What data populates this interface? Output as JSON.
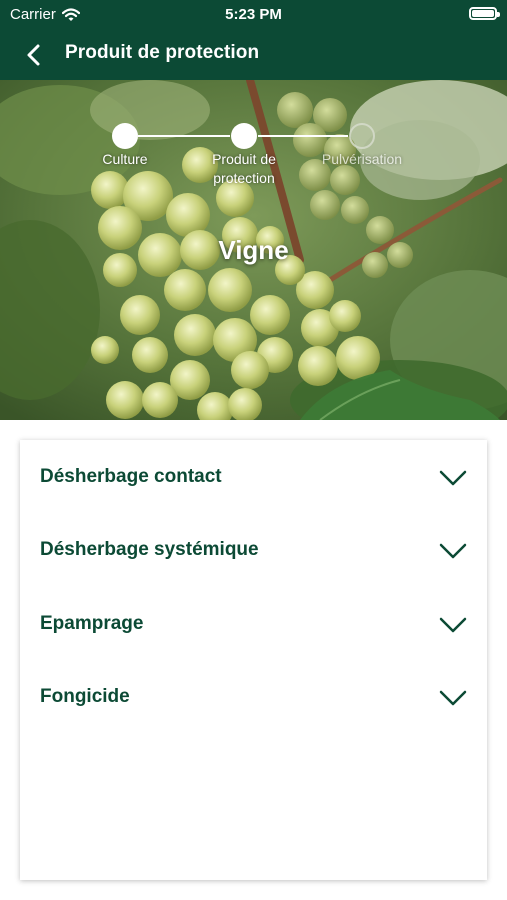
{
  "status_bar": {
    "carrier": "Carrier",
    "time": "5:23 PM"
  },
  "nav": {
    "title": "Produit de protection"
  },
  "stepper": {
    "steps": [
      {
        "label_line1": "Culture",
        "label_line2": "",
        "state": "done"
      },
      {
        "label_line1": "Produit de",
        "label_line2": "protection",
        "state": "current"
      },
      {
        "label_line1": "Pulvérisation",
        "label_line2": "",
        "state": "pending"
      }
    ]
  },
  "hero": {
    "crop_name": "Vigne"
  },
  "categories": [
    {
      "label": "Désherbage contact"
    },
    {
      "label": "Désherbage systémique"
    },
    {
      "label": "Epamprage"
    },
    {
      "label": "Fongicide"
    }
  ],
  "colors": {
    "primary": "#0c4a35",
    "background": "#ffffff"
  }
}
